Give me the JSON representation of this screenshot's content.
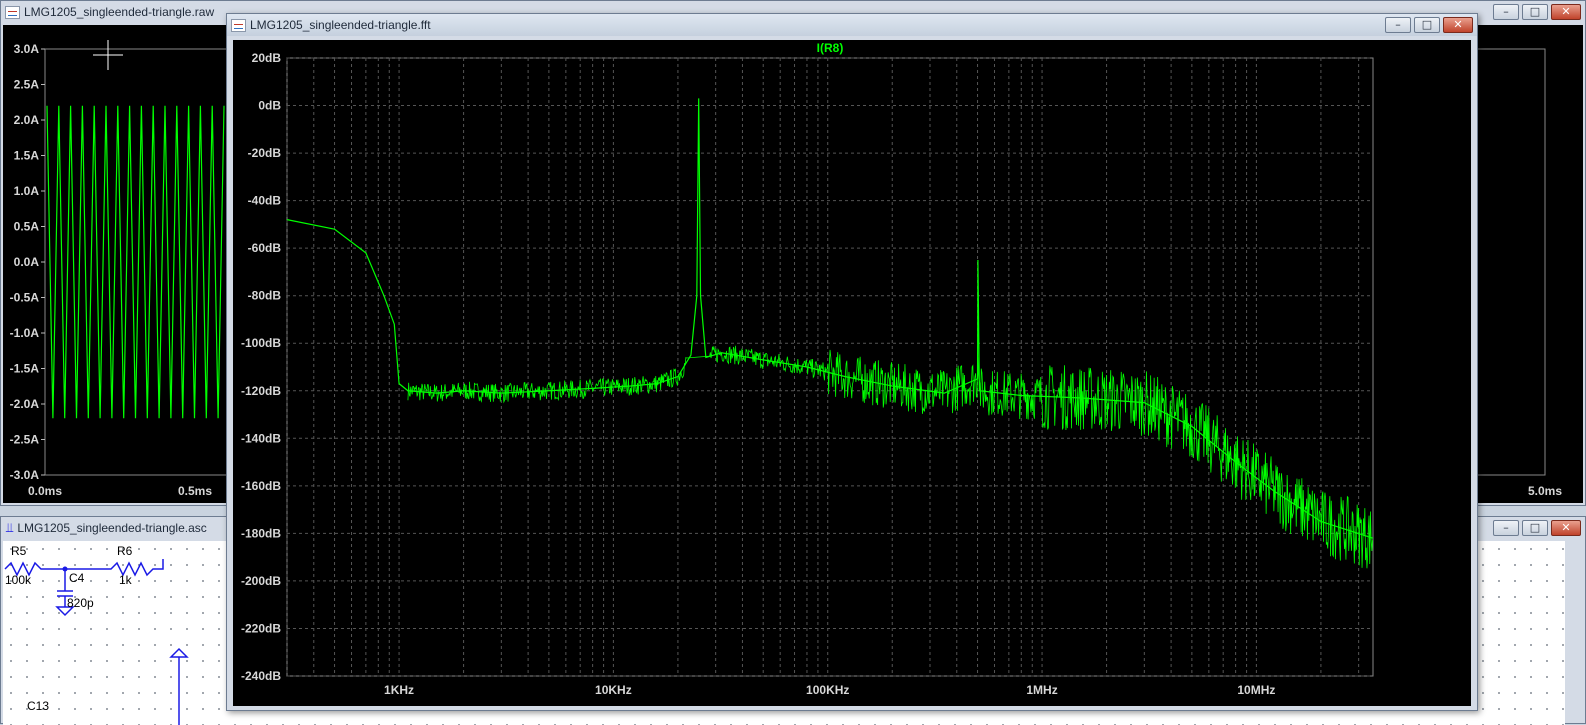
{
  "colors": {
    "trace": "#00ff00",
    "plot_bg": "#000000",
    "grid": "#555555",
    "axis_text": "#d8d8d8",
    "wire": "#1a1ae6"
  },
  "windows": {
    "raw": {
      "title": "LMG1205_singleended-triangle.raw"
    },
    "asc": {
      "title": "LMG1205_singleended-triangle.asc"
    },
    "fft": {
      "title": "LMG1205_singleended-triangle.fft"
    }
  },
  "window_controls": {
    "minimize": "minimize-icon",
    "restore": "restore-icon",
    "close": "close-icon"
  },
  "raw_plot": {
    "y_ticks": [
      "3.0A",
      "2.5A",
      "2.0A",
      "1.5A",
      "1.0A",
      "0.5A",
      "0.0A",
      "-0.5A",
      "-1.0A",
      "-1.5A",
      "-2.0A",
      "-2.5A",
      "-3.0A"
    ],
    "x_ticks_visible": [
      "0.0ms",
      "0.5ms"
    ],
    "x_tick_right": "5.0ms"
  },
  "schematic": {
    "labels": [
      "R5",
      "100k",
      "R6",
      "1k",
      "C4",
      "820p",
      "C13"
    ]
  },
  "chart_data": {
    "type": "line",
    "title": "I(R8)",
    "xlabel": "",
    "ylabel": "",
    "x_scale": "log",
    "ylim": [
      -240,
      20
    ],
    "y_ticks": [
      "20dB",
      "0dB",
      "-20dB",
      "-40dB",
      "-60dB",
      "-80dB",
      "-100dB",
      "-120dB",
      "-140dB",
      "-160dB",
      "-180dB",
      "-200dB",
      "-220dB",
      "-240dB"
    ],
    "x_ticks": [
      "1KHz",
      "10KHz",
      "100KHz",
      "1MHz",
      "10MHz"
    ],
    "series": [
      {
        "name": "I(R8)",
        "x_hz": [
          300,
          500,
          700,
          850,
          950,
          1000,
          1100,
          1500,
          2000,
          3000,
          5000,
          8000,
          12000,
          16000,
          20000,
          23000,
          24500,
          25000,
          25500,
          27000,
          32000,
          50000,
          80000,
          120000,
          200000,
          350000,
          500000,
          502000,
          510000,
          800000,
          1500000,
          3000000,
          5000000,
          8000000,
          12000000,
          20000000,
          35000000
        ],
        "y_db": [
          -48,
          -52,
          -62,
          -80,
          -92,
          -117,
          -120,
          -121,
          -120,
          -121,
          -120,
          -119,
          -118,
          -117,
          -114,
          -105,
          -80,
          3,
          -80,
          -106,
          -104,
          -107,
          -110,
          -114,
          -118,
          -121,
          -115,
          -65,
          -120,
          -122,
          -123,
          -125,
          -135,
          -150,
          -162,
          -175,
          -182
        ]
      }
    ]
  }
}
